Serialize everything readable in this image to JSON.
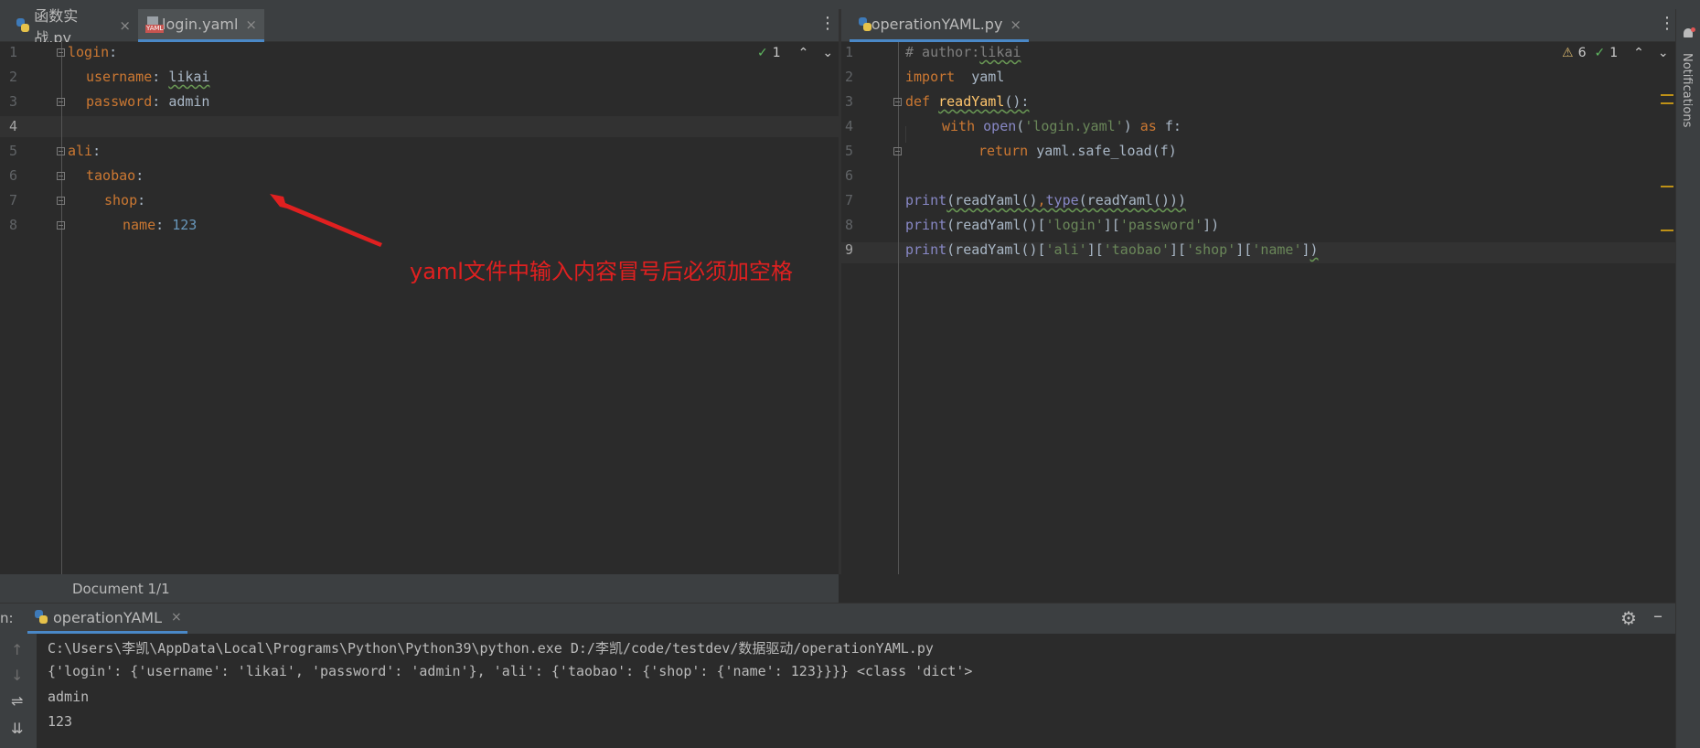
{
  "left_tabs": [
    {
      "label": "函数实战.py",
      "icon": "python-file-icon"
    },
    {
      "label": "login.yaml",
      "icon": "yaml-file-icon"
    }
  ],
  "right_tabs": [
    {
      "label": "operationYAML.py",
      "icon": "python-file-icon"
    }
  ],
  "tab_close": "×",
  "yaml_icon_label": "YAML",
  "left_editor": {
    "line_numbers": [
      "1",
      "2",
      "3",
      "4",
      "5",
      "6",
      "7",
      "8"
    ],
    "inspection_count": "1",
    "lines": {
      "l1_key": "login",
      "l2_key": "username",
      "l2_val": "likai",
      "l3_key": "password",
      "l3_val": "admin",
      "l5_key": "ali",
      "l6_key": "taobao",
      "l7_key": "shop",
      "l8_key": "name",
      "l8_val": "123"
    }
  },
  "right_editor": {
    "line_numbers": [
      "1",
      "2",
      "3",
      "4",
      "5",
      "6",
      "7",
      "8",
      "9"
    ],
    "warning_count": "6",
    "inspection_count": "1",
    "code": {
      "comment": "# author:",
      "author": "likai",
      "import_kw": "import",
      "import_mod": "yaml",
      "def_kw": "def",
      "func_name": "readYaml",
      "def_tail": "():",
      "with_kw": "with",
      "open_fn": "open",
      "open_arg": "'login.yaml'",
      "as_kw": "as",
      "as_var": "f:",
      "return_kw": "return",
      "return_expr": "yaml.safe_load(f)",
      "print_kw": "print",
      "l7_a": "(readYaml()",
      "l7_b": ",",
      "type_kw": "type",
      "l7_c": "(readYaml()))",
      "l8_a": "(readYaml()[",
      "s_login": "'login'",
      "br": "][",
      "s_password": "'password'",
      "close": "])",
      "l9_a": "(readYaml()[",
      "s_ali": "'ali'",
      "s_taobao": "'taobao'",
      "s_shop": "'shop'",
      "s_name": "'name'",
      "close_bracket": "]",
      "close_paren": ")"
    }
  },
  "annotation": "yaml文件中输入内容冒号后必须加空格",
  "status": {
    "document": "Document 1/1"
  },
  "run": {
    "prefix": "n:",
    "tab_label": "operationYAML",
    "console_lines": [
      "C:\\Users\\李凯\\AppData\\Local\\Programs\\Python\\Python39\\python.exe D:/李凯/code/testdev/数据驱动/operationYAML.py",
      "{'login': {'username': 'likai', 'password': 'admin'}, 'ali': {'taobao': {'shop': {'name': 123}}}} <class 'dict'>",
      "admin",
      "123"
    ]
  },
  "notifications_label": "Notifications",
  "colors": {
    "annotation": "#e02020",
    "accent": "#4a88c7",
    "keyword": "#cc7832",
    "string": "#6a8759"
  }
}
